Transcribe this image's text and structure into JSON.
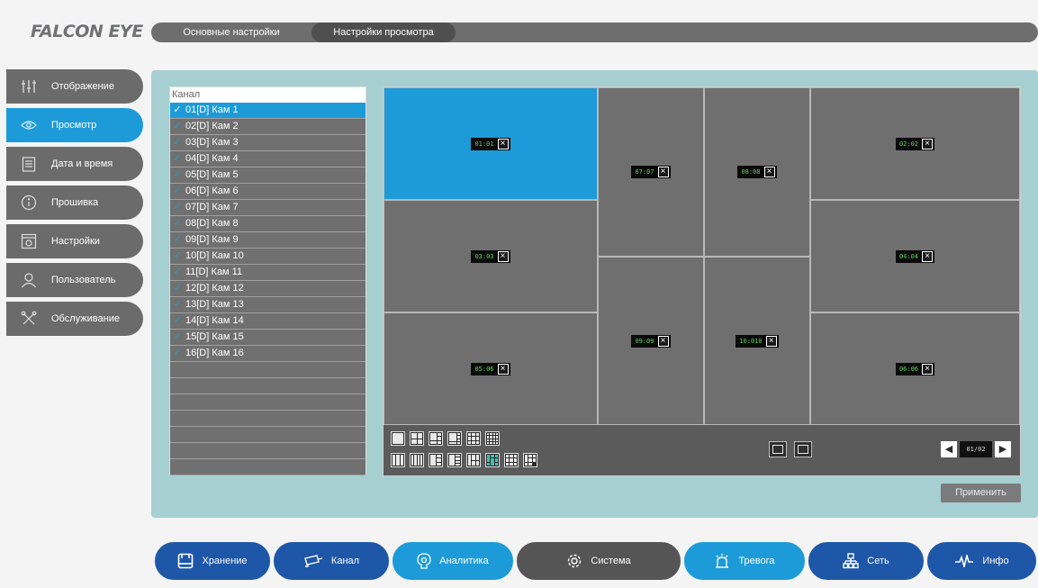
{
  "logo": "FALCON EYE",
  "top_tabs": [
    "Основные настройки",
    "Настройки просмотра"
  ],
  "sidebar": {
    "items": [
      {
        "label": "Отображение",
        "icon": "sliders-icon"
      },
      {
        "label": "Просмотр",
        "icon": "eye-icon"
      },
      {
        "label": "Дата и время",
        "icon": "calendar-icon"
      },
      {
        "label": "Прошивка",
        "icon": "info-icon"
      },
      {
        "label": "Настройки",
        "icon": "settings-box-icon"
      },
      {
        "label": "Пользователь",
        "icon": "user-icon"
      },
      {
        "label": "Обслуживание",
        "icon": "tools-icon"
      }
    ]
  },
  "channel_list": {
    "header": "Канал",
    "items": [
      "01[D] Кам 1",
      "02[D] Кам 2",
      "03[D] Кам 3",
      "04[D] Кам 4",
      "05[D] Кам 5",
      "06[D] Кам 6",
      "07[D] Кам 7",
      "08[D] Кам 8",
      "09[D] Кам 9",
      "10[D] Кам 10",
      "11[D] Кам 11",
      "12[D] Кам 12",
      "13[D] Кам 13",
      "14[D] Кам 14",
      "15[D] Кам 15",
      "16[D] Кам 16"
    ]
  },
  "preview": {
    "cells": {
      "c1": "01:01",
      "c2": "03:03",
      "c3": "05:06",
      "c4": "07:07",
      "c5": "08:08",
      "c6": "09:09",
      "c7": "10:010",
      "c8": "02:02",
      "c9": "04:04",
      "c10": "06:06"
    },
    "page": "01/02"
  },
  "apply_label": "Применить",
  "bottom_nav": [
    {
      "label": "Хранение",
      "icon": "storage-icon"
    },
    {
      "label": "Канал",
      "icon": "camera-icon"
    },
    {
      "label": "Аналитика",
      "icon": "analytics-icon"
    },
    {
      "label": "Система",
      "icon": "gear-icon"
    },
    {
      "label": "Тревога",
      "icon": "alarm-icon"
    },
    {
      "label": "Сеть",
      "icon": "network-icon"
    },
    {
      "label": "Инфо",
      "icon": "pulse-icon"
    }
  ],
  "colors": {
    "accent": "#1d9bd9",
    "nav_dark": "#1f57a8",
    "panel": "#a6cfd2"
  }
}
